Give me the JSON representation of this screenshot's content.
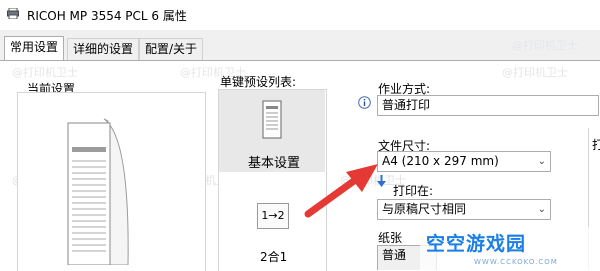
{
  "window": {
    "title": "RICOH MP 3554 PCL 6 属性"
  },
  "tabs": [
    {
      "label": "常用设置",
      "active": true
    },
    {
      "label": "详细的设置",
      "active": false
    },
    {
      "label": "配置/关于",
      "active": false
    }
  ],
  "current_settings": {
    "label": "当前设置"
  },
  "presets": {
    "label": "单键预设列表:",
    "items": [
      {
        "label": "基本设置",
        "selected": true
      },
      {
        "label": "2合1",
        "icon_text": "1→2",
        "selected": false
      }
    ]
  },
  "job_type": {
    "label": "作业方式:",
    "value": "普通打印"
  },
  "document_size": {
    "label": "文件尺寸:",
    "value": "A4 (210 x 297 mm)"
  },
  "print_on": {
    "label": "打印在:",
    "value": "与原稿尺寸相同"
  },
  "paper": {
    "label": "纸张",
    "value": "普通"
  },
  "right_cut": {
    "label": "打"
  },
  "watermarks": {
    "text": "@打印机卫士"
  },
  "overlay_logo": {
    "text": "空空游戏园",
    "url": "WWW.CCKOKO.COM",
    "accent": "#1a7fe6"
  },
  "annotation": {
    "arrow_color": "#e53935"
  },
  "colors": {
    "panel": "#ffffff",
    "chrome": "#f0f0f0",
    "selection": "#e8e8e8"
  }
}
